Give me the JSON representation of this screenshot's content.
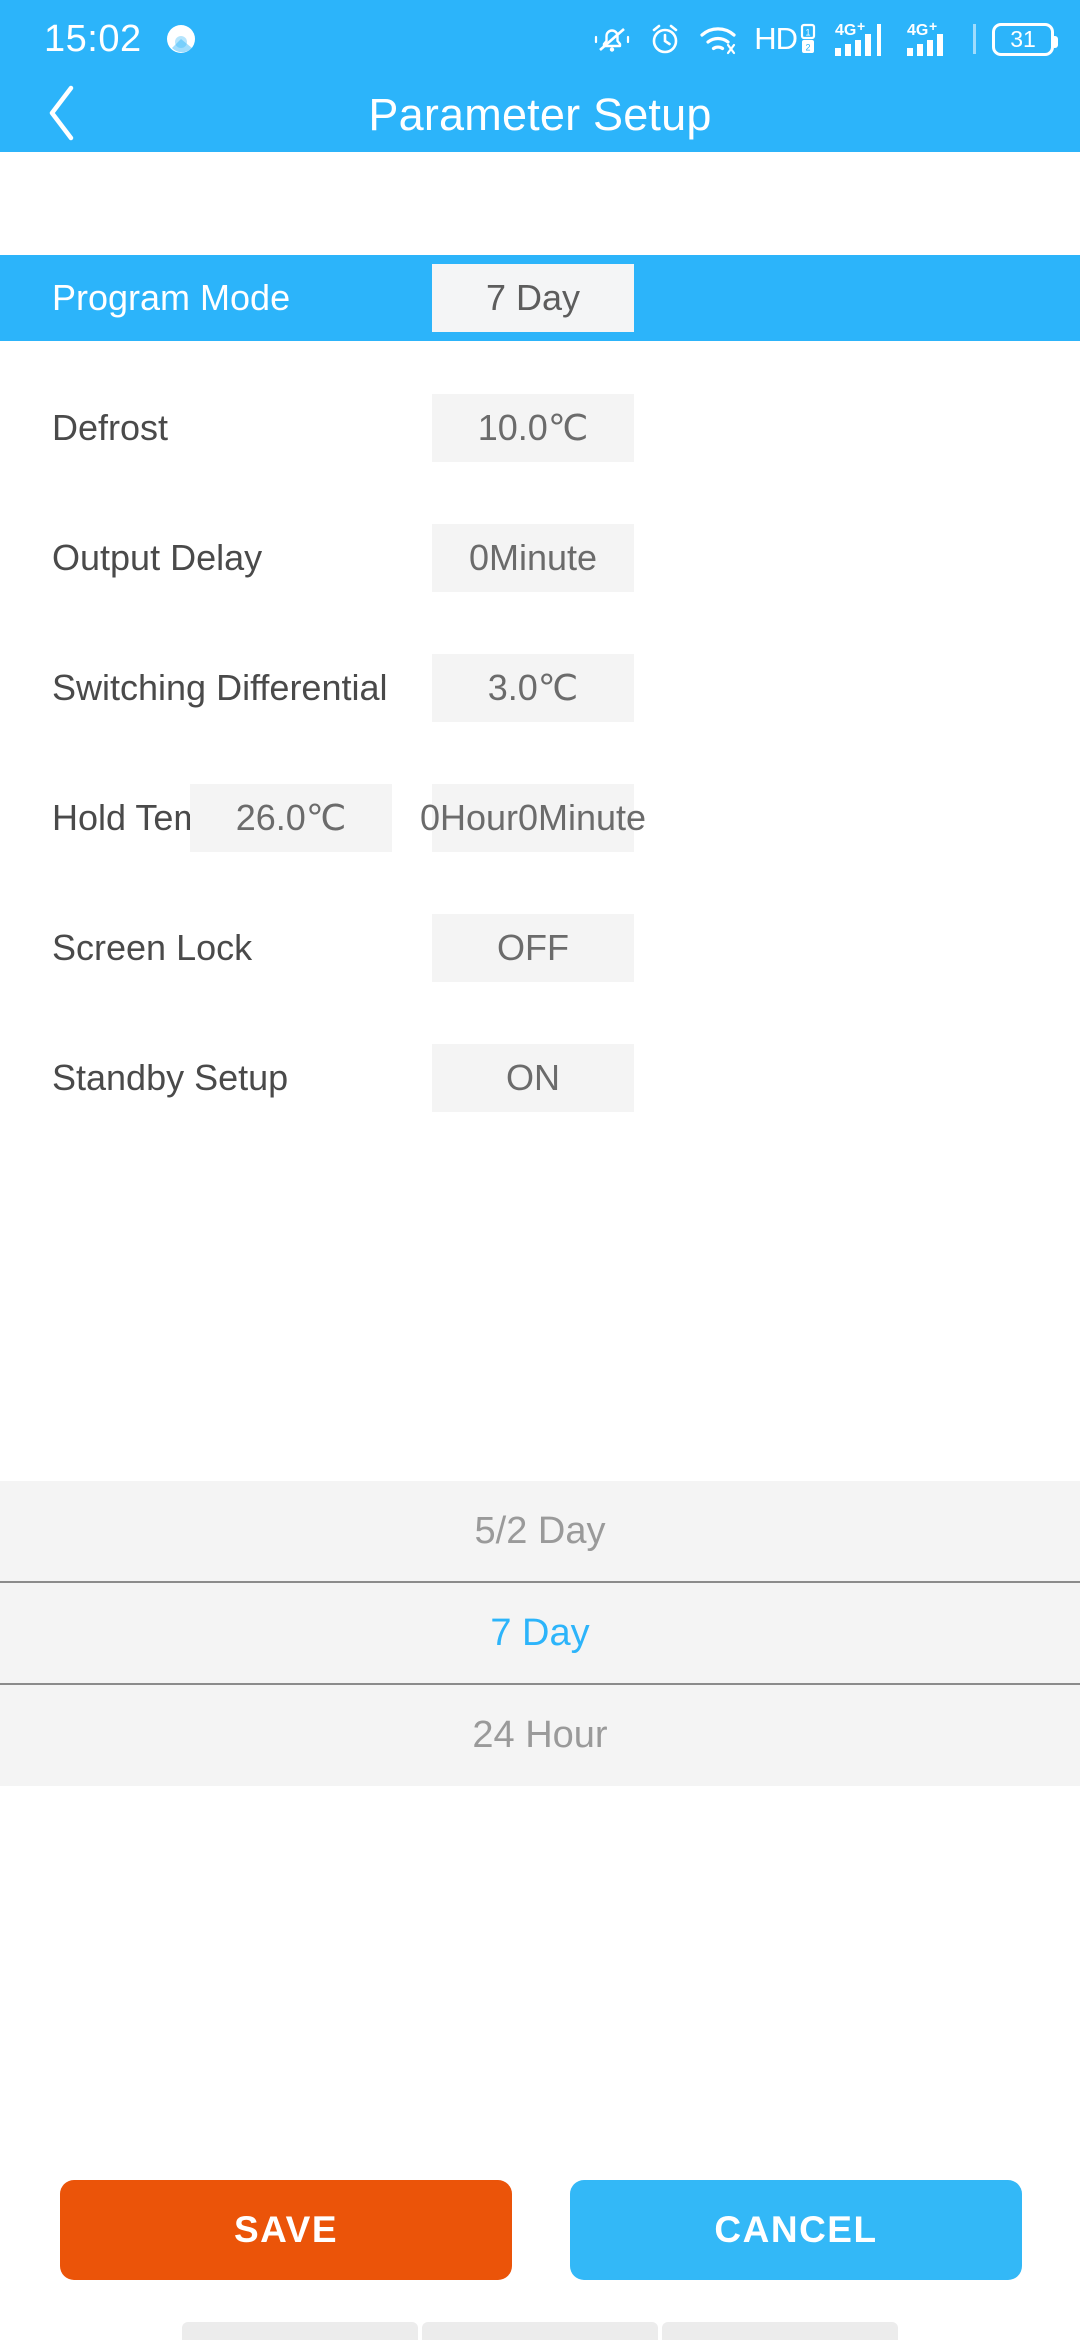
{
  "status_bar": {
    "time": "15:02",
    "battery_percent": "31",
    "icons": [
      "assistant-orb-icon",
      "bell-muted-icon",
      "alarm-clock-icon",
      "wifi-icon",
      "hd-dual-sim-icon",
      "signal-4g-plus-icon",
      "signal-4g-plus-icon",
      "battery-icon"
    ],
    "hd_label": "HD",
    "sim1_label": "4G",
    "sim2_label": "4G"
  },
  "app_bar": {
    "title": "Parameter Setup",
    "back_icon": "chevron-left-icon"
  },
  "parameters": [
    {
      "label": "Program Mode",
      "value": "7 Day",
      "selected": true,
      "sub_value": null
    },
    {
      "label": "Defrost",
      "value": "10.0℃",
      "selected": false,
      "sub_value": null
    },
    {
      "label": "Output Delay",
      "value": "0Minute",
      "selected": false,
      "sub_value": null
    },
    {
      "label": "Switching Differential",
      "value": "3.0℃",
      "selected": false,
      "sub_value": null
    },
    {
      "label": "Hold Temp",
      "value": "0Hour0Minute",
      "selected": false,
      "sub_value": "26.0℃"
    },
    {
      "label": "Screen Lock",
      "value": "OFF",
      "selected": false,
      "sub_value": null
    },
    {
      "label": "Standby Setup",
      "value": "ON",
      "selected": false,
      "sub_value": null
    }
  ],
  "picker": {
    "options": [
      {
        "label": "5/2 Day",
        "active": false
      },
      {
        "label": "7 Day",
        "active": true
      },
      {
        "label": "24 Hour",
        "active": false
      }
    ],
    "selected": "7 Day"
  },
  "actions": {
    "save_label": "SAVE",
    "cancel_label": "CANCEL"
  },
  "colors": {
    "accent_blue": "#2cb4fa",
    "save_orange": "#eb5409",
    "cancel_blue": "#33b8f7",
    "value_box_bg": "#f4f4f4",
    "picker_bg": "#f4f4f4",
    "label_gray": "#4a4a4a",
    "value_gray": "#6b6b6b",
    "picker_inactive": "#9a9a9a"
  }
}
